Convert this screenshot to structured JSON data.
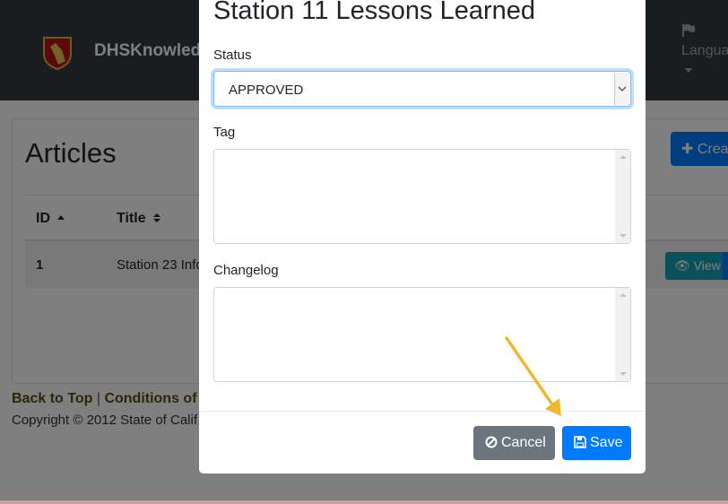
{
  "navbar": {
    "brand": "DHSKnowled",
    "language": "Langua"
  },
  "page": {
    "title": "Articles",
    "create_button": "Creat",
    "table": {
      "headers": {
        "id": "ID",
        "title": "Title"
      },
      "rows": [
        {
          "id": "1",
          "title": "Station 23 Info",
          "view_label": "View"
        }
      ]
    }
  },
  "footer": {
    "back_to_top": "Back to Top",
    "separator": "|",
    "conditions": "Conditions of U",
    "copyright": "Copyright © 2012 State of Calif"
  },
  "modal": {
    "title": "Station 11 Lessons Learned",
    "status_label": "Status",
    "status_value": "APPROVED",
    "tag_label": "Tag",
    "changelog_label": "Changelog",
    "cancel_label": "Cancel",
    "save_label": "Save"
  },
  "colors": {
    "primary": "#007bff",
    "secondary": "#6c757d",
    "info": "#17a2b8",
    "navbar": "#343a40",
    "annotation_arrow": "#f2b731"
  },
  "icons": {
    "cancel": "ban-icon",
    "save": "floppy-disk-icon",
    "view": "eye-icon",
    "edit": "pencil-icon",
    "create": "plus-icon",
    "language": "flag-icon"
  }
}
